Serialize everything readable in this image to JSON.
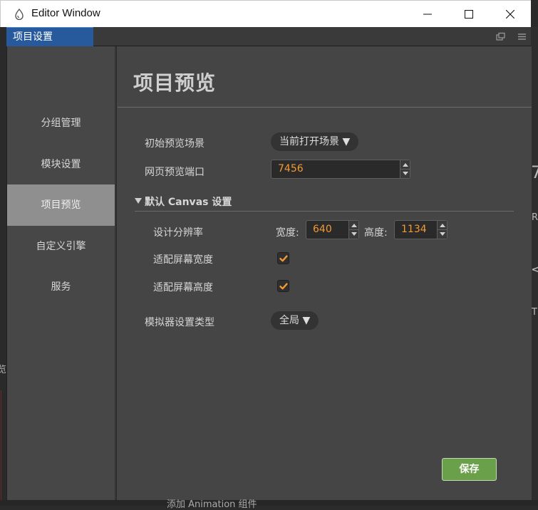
{
  "window": {
    "title": "Editor Window"
  },
  "panel_tab": {
    "label": "项目设置"
  },
  "sidebar": {
    "items": [
      {
        "label": "分组管理",
        "active": false
      },
      {
        "label": "模块设置",
        "active": false
      },
      {
        "label": "项目预览",
        "active": true
      },
      {
        "label": "自定义引擎",
        "active": false
      },
      {
        "label": "服务",
        "active": false
      }
    ]
  },
  "main": {
    "heading": "项目预览",
    "initial_scene": {
      "label": "初始预览场景",
      "value": "当前打开场景 ▼"
    },
    "web_port": {
      "label": "网页预览端口",
      "value": "7456"
    },
    "canvas_section": {
      "title": "默认 Canvas 设置",
      "resolution": {
        "label": "设计分辨率",
        "width_label": "宽度:",
        "width": "640",
        "height_label": "高度:",
        "height": "1134"
      },
      "fit_width": {
        "label": "适配屏幕宽度",
        "checked": true
      },
      "fit_height": {
        "label": "适配屏幕高度",
        "checked": true
      }
    },
    "simulator": {
      "label": "模拟器设置类型",
      "value": "全局 ▼"
    },
    "save_label": "保存"
  },
  "background": {
    "right_fragments": [
      "7",
      "R",
      "<",
      "T"
    ],
    "left_fragment": "览",
    "bottom_fragment": "添加 Animation 组件"
  },
  "colors": {
    "accent": "#f39a35",
    "tab_active": "#265a9c",
    "save_button": "#6aa049",
    "nav_active": "#8f8f8f"
  }
}
